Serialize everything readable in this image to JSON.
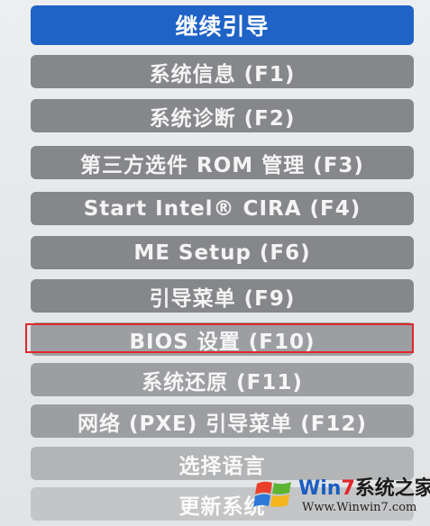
{
  "menu": {
    "items": [
      {
        "label": "继续引导",
        "style": "primary"
      },
      {
        "label": "系统信息 (F1)",
        "style": "normal"
      },
      {
        "label": "系统诊断 (F2)",
        "style": "normal"
      },
      {
        "label": "第三方选件 ROM 管理 (F3)",
        "style": "normal"
      },
      {
        "label": "Start Intel® CIRA (F4)",
        "style": "normal"
      },
      {
        "label": "ME Setup (F6)",
        "style": "normal"
      },
      {
        "label": "引导菜单 (F9)",
        "style": "normal"
      },
      {
        "label": "BIOS 设置 (F10)",
        "style": "faded",
        "highlighted": true
      },
      {
        "label": "系统还原 (F11)",
        "style": "faded"
      },
      {
        "label": "网络 (PXE) 引导菜单 (F12)",
        "style": "faded"
      },
      {
        "label": "选择语言",
        "style": "faded2"
      },
      {
        "label": "更新系统",
        "style": "faded3"
      }
    ],
    "highlight_color": "#e0272d",
    "primary_color": "#1f63c6"
  },
  "watermark": {
    "title_win": "Win",
    "title_seven": "7",
    "title_rest": "系统之家",
    "url": "Www.Winwin7.com",
    "icon": "windows-flag-logo"
  }
}
